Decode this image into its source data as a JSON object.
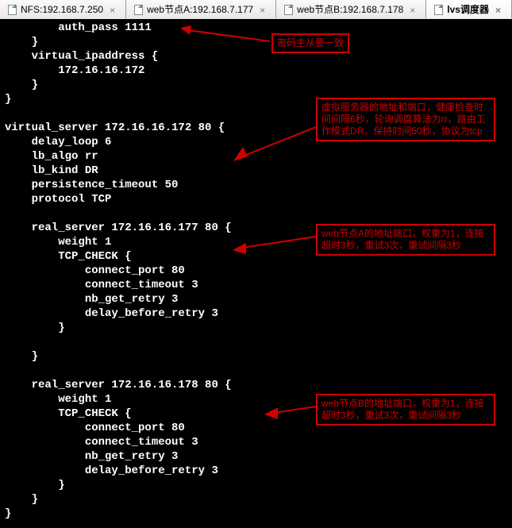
{
  "tabs": [
    {
      "label": "NFS:192.168.7.250"
    },
    {
      "label": "web节点A:192.168.7.177"
    },
    {
      "label": "web节点B:192.168.7.178"
    },
    {
      "label": "lvs调度器"
    }
  ],
  "code": {
    "l01": "        auth_pass 1111",
    "l02": "    }",
    "l03": "    virtual_ipaddress {",
    "l04": "        172.16.16.172",
    "l05": "    }",
    "l06": "}",
    "l07": "",
    "l08": "virtual_server 172.16.16.172 80 {",
    "l09": "    delay_loop 6",
    "l10": "    lb_algo rr",
    "l11": "    lb_kind DR",
    "l12": "    persistence_timeout 50",
    "l13": "    protocol TCP",
    "l14": "",
    "l15": "    real_server 172.16.16.177 80 {",
    "l16": "        weight 1",
    "l17": "        TCP_CHECK {",
    "l18": "            connect_port 80",
    "l19": "            connect_timeout 3",
    "l20": "            nb_get_retry 3",
    "l21": "            delay_before_retry 3",
    "l22": "        }",
    "l23": "",
    "l24": "    }",
    "l25": "",
    "l26": "    real_server 172.16.16.178 80 {",
    "l27": "        weight 1",
    "l28": "        TCP_CHECK {",
    "l29": "            connect_port 80",
    "l30": "            connect_timeout 3",
    "l31": "            nb_get_retry 3",
    "l32": "            delay_before_retry 3",
    "l33": "        }",
    "l34": "    }",
    "l35": "}"
  },
  "annotations": {
    "a1": "密码主从要一致",
    "a2": "虚拟服务器的地址和端口，健康检查时间间隔6秒，轮询调度算法为rr，路由工作模式DR，保持时间50秒，协议为tcp",
    "a3": "web节点A的地址端口，权重为1，连接超时3秒，重试3次，重试间隔3秒",
    "a4": "web节点B的地址端口，权重为1，连接超时3秒，重试3次，重试间隔3秒"
  }
}
